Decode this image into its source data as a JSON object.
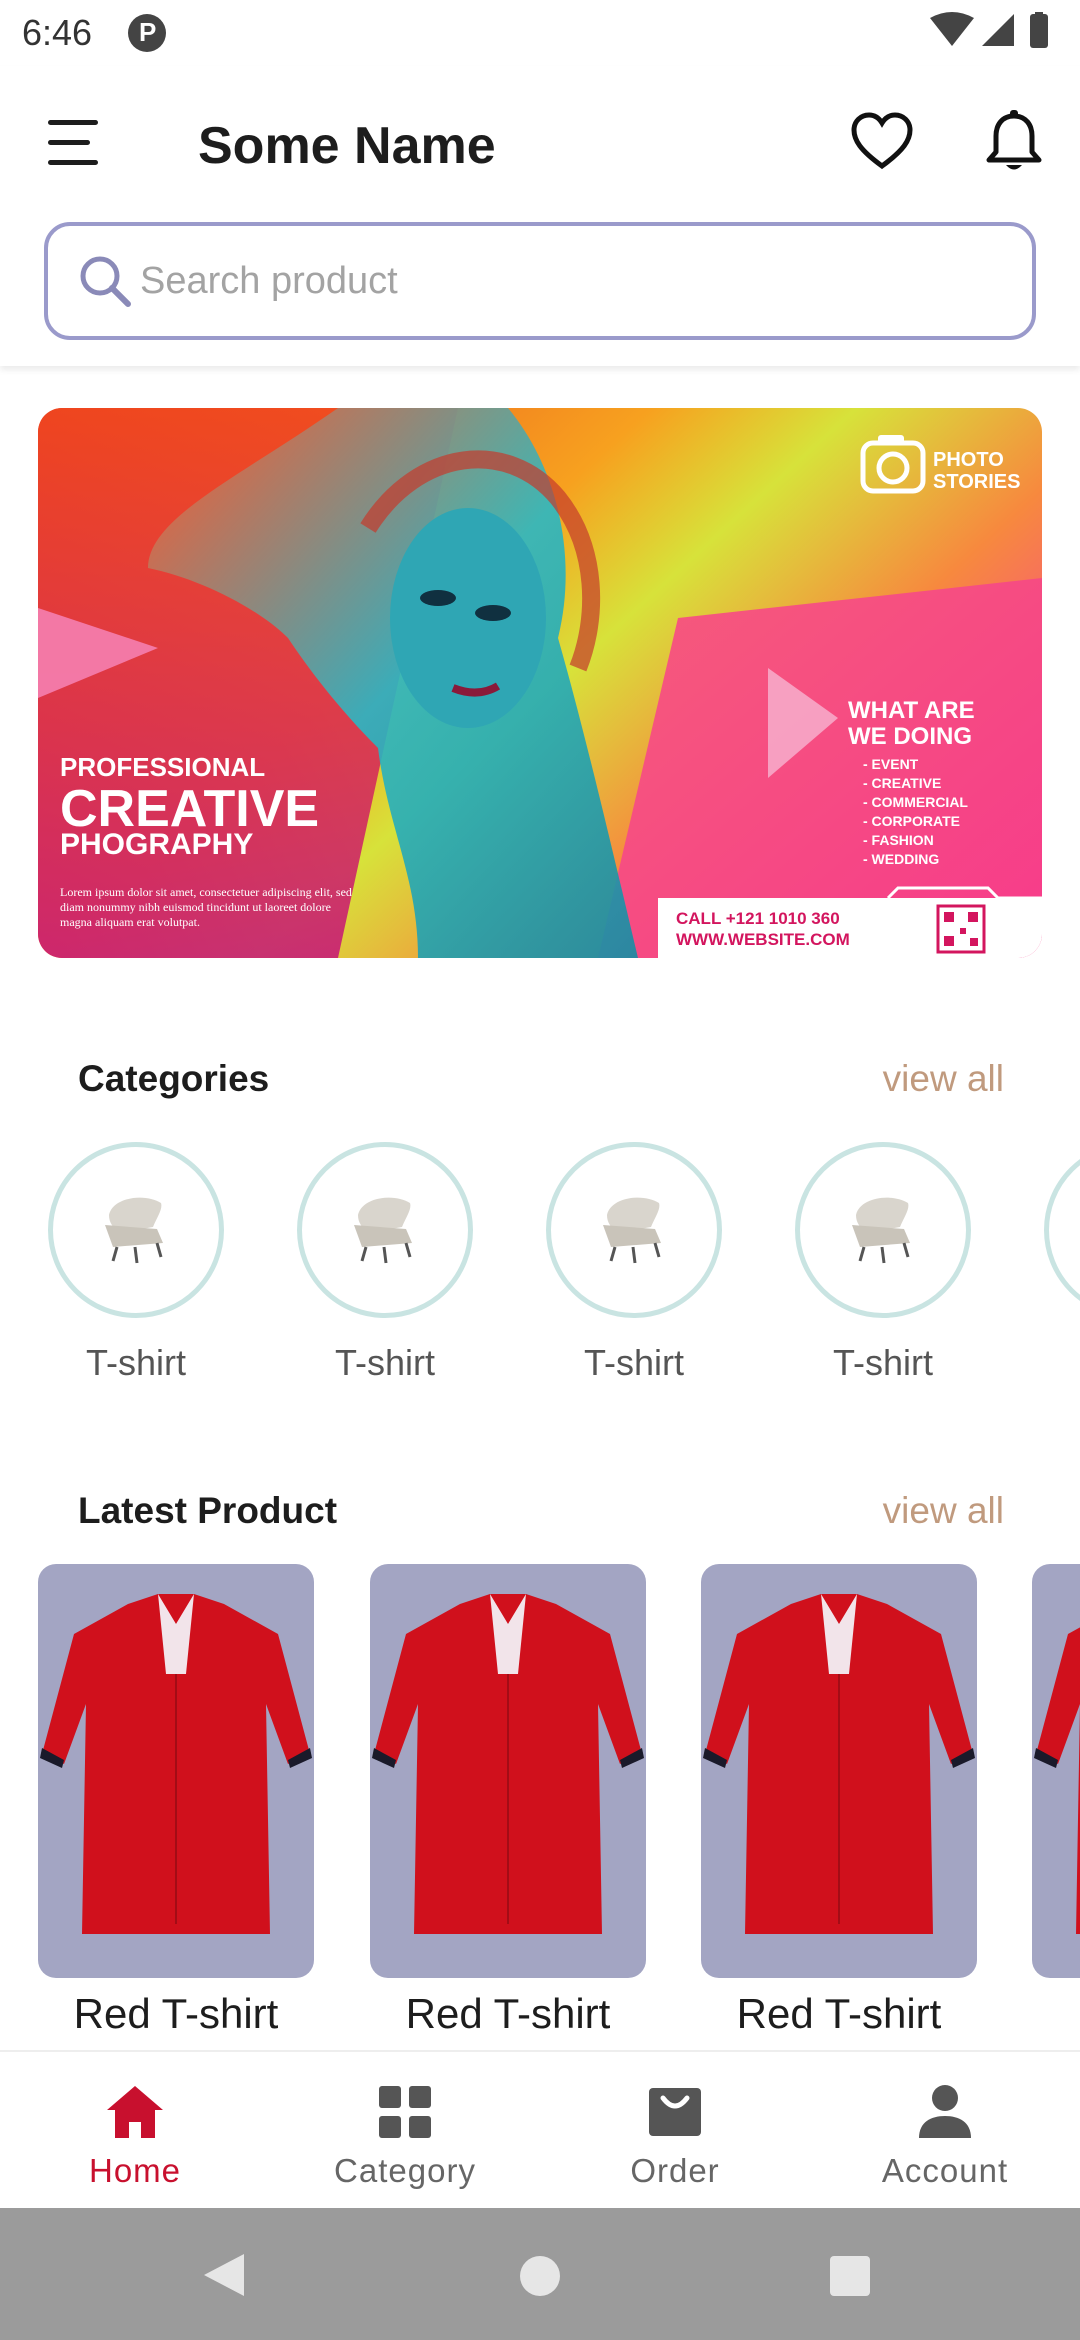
{
  "status_bar": {
    "time": "6:46"
  },
  "app_bar": {
    "title": "Some Name"
  },
  "search": {
    "placeholder": "Search product"
  },
  "banner": {
    "brand_line1": "PHOTO",
    "brand_line2": "STORIES",
    "headline_1": "PROFESSIONAL",
    "headline_2": "CREATIVE",
    "headline_3": "PHOGRAPHY",
    "body_1": "Lorem ipsum dolor sit amet, consectetuer adipiscing elit, sed",
    "body_2": "diam nonummy nibh euismod tincidunt ut laoreet dolore",
    "body_3": "magna aliquam erat volutpat.",
    "what_1": "WHAT ARE",
    "what_2": "WE DOING",
    "services": [
      "- EVENT",
      "- CREATIVE",
      "- COMMERCIAL",
      "- CORPORATE",
      "- FASHION",
      "- WEDDING"
    ],
    "call": "CALL +121 1010 360",
    "website": "WWW.WEBSITE.COM"
  },
  "categories": {
    "title": "Categories",
    "view_all": "view all",
    "items": [
      {
        "label": "T-shirt"
      },
      {
        "label": "T-shirt"
      },
      {
        "label": "T-shirt"
      },
      {
        "label": "T-shirt"
      }
    ]
  },
  "latest": {
    "title": "Latest Product",
    "view_all": "view all",
    "items": [
      {
        "label": "Red T-shirt"
      },
      {
        "label": "Red T-shirt"
      },
      {
        "label": "Red T-shirt"
      }
    ]
  },
  "bottom_nav": {
    "items": [
      {
        "label": "Home",
        "icon": "home-icon",
        "active": true
      },
      {
        "label": "Category",
        "icon": "grid-icon",
        "active": false
      },
      {
        "label": "Order",
        "icon": "bag-icon",
        "active": false
      },
      {
        "label": "Account",
        "icon": "person-icon",
        "active": false
      }
    ]
  },
  "colors": {
    "accent": "#c8102e",
    "view_all": "#c09a7e",
    "search_border": "#9a9acb",
    "product_bg": "#a3a5c3",
    "category_ring": "#c9e4e2"
  }
}
